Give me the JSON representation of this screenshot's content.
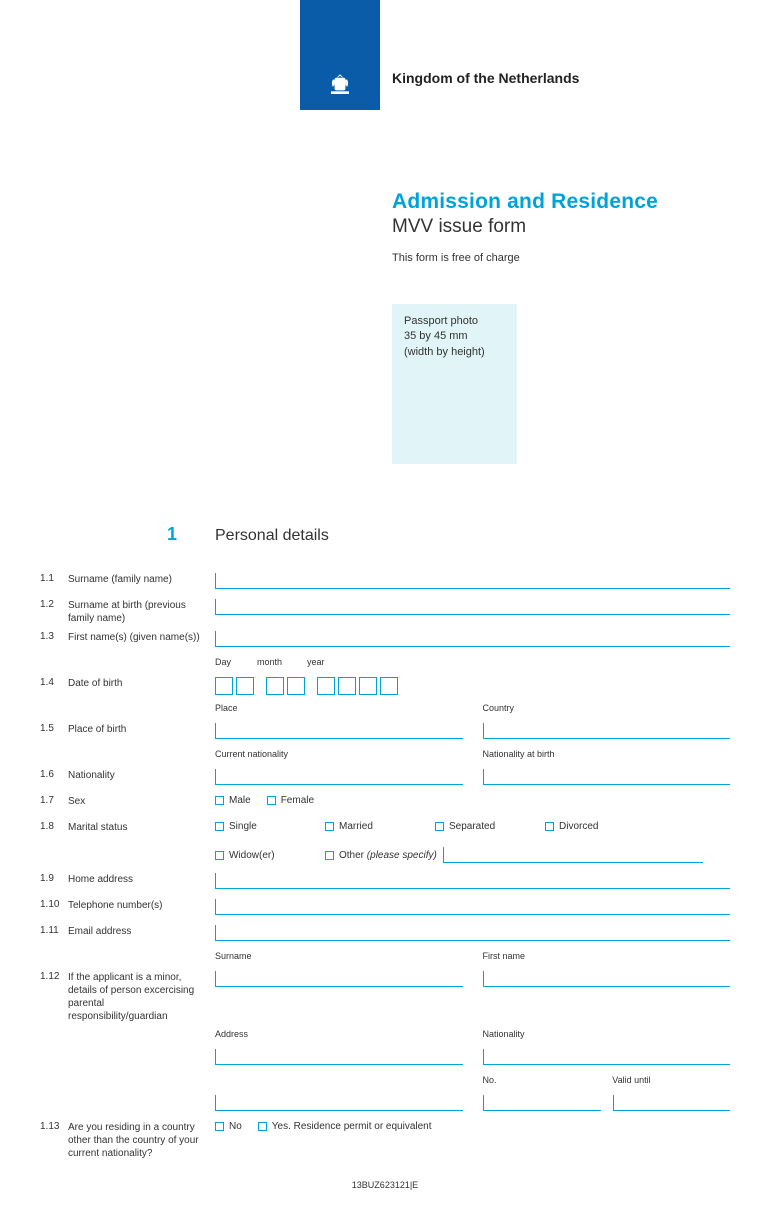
{
  "header": {
    "kingdom": "Kingdom of the Netherlands",
    "title1": "Admission and Residence",
    "title2": "MVV issue form",
    "subtitle": "This form is free of charge"
  },
  "photo": {
    "line1": "Passport photo",
    "line2": "35 by 45 mm",
    "line3": "(width by height)"
  },
  "section": {
    "num": "1",
    "title": "Personal details"
  },
  "items": {
    "i1_1": {
      "num": "1.1",
      "label": "Surname (family name)"
    },
    "i1_2": {
      "num": "1.2",
      "label": "Surname at birth (previous family name)"
    },
    "i1_3": {
      "num": "1.3",
      "label": "First name(s) (given name(s))"
    },
    "i1_4": {
      "num": "1.4",
      "label": "Date of birth",
      "day": "Day",
      "month": "month",
      "year": "year"
    },
    "i1_5": {
      "num": "1.5",
      "label": "Place of birth",
      "place": "Place",
      "country": "Country"
    },
    "i1_6": {
      "num": "1.6",
      "label": "Nationality",
      "current": "Current nationality",
      "atbirth": "Nationality at birth"
    },
    "i1_7": {
      "num": "1.7",
      "label": "Sex",
      "male": "Male",
      "female": "Female"
    },
    "i1_8": {
      "num": "1.8",
      "label": "Marital status",
      "single": "Single",
      "married": "Married",
      "separated": "Separated",
      "divorced": "Divorced",
      "widower": "Widow(er)",
      "other": "Other",
      "specify": "(please specify)"
    },
    "i1_9": {
      "num": "1.9",
      "label": "Home address"
    },
    "i1_10": {
      "num": "1.10",
      "label": "Telephone number(s)"
    },
    "i1_11": {
      "num": "1.11",
      "label": "Email address"
    },
    "i1_12": {
      "num": "1.12",
      "label": "If the applicant is a minor, details of person excercising parental responsibility/guardian",
      "surname": "Surname",
      "firstname": "First name",
      "address": "Address",
      "nationality": "Nationality",
      "no": "No.",
      "valid": "Valid until"
    },
    "i1_13": {
      "num": "1.13",
      "label": "Are you residing in a country other than the country of your current nationality?",
      "no": "No",
      "yes": "Yes. Residence permit or equivalent"
    }
  },
  "footer": "13BUZ623121|E"
}
